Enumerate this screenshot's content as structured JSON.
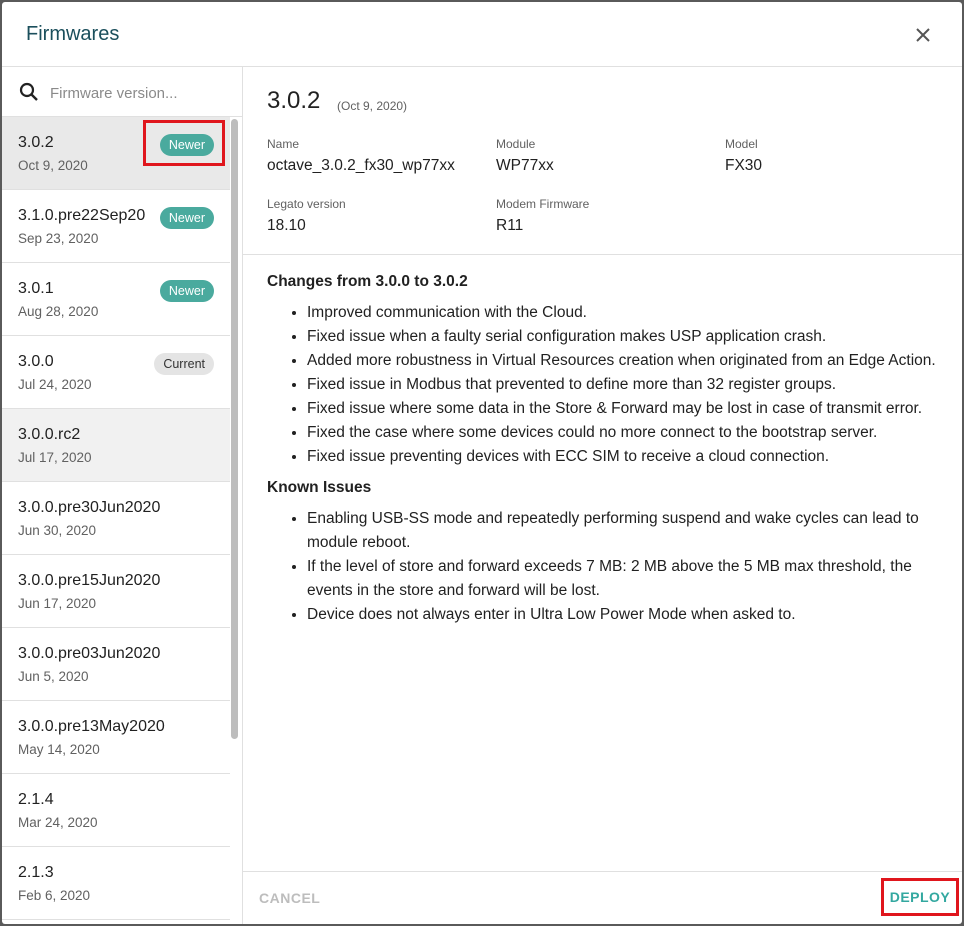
{
  "dialog": {
    "title": "Firmwares"
  },
  "search": {
    "placeholder": "Firmware version..."
  },
  "firmwares": [
    {
      "version": "3.0.2",
      "date": "Oct 9, 2020",
      "badge": "Newer"
    },
    {
      "version": "3.1.0.pre22Sep20",
      "date": "Sep 23, 2020",
      "badge": "Newer"
    },
    {
      "version": "3.0.1",
      "date": "Aug 28, 2020",
      "badge": "Newer"
    },
    {
      "version": "3.0.0",
      "date": "Jul 24, 2020",
      "badge": "Current"
    },
    {
      "version": "3.0.0.rc2",
      "date": "Jul 17, 2020"
    },
    {
      "version": "3.0.0.pre30Jun2020",
      "date": "Jun 30, 2020"
    },
    {
      "version": "3.0.0.pre15Jun2020",
      "date": "Jun 17, 2020"
    },
    {
      "version": "3.0.0.pre03Jun2020",
      "date": "Jun 5, 2020"
    },
    {
      "version": "3.0.0.pre13May2020",
      "date": "May 14, 2020"
    },
    {
      "version": "2.1.4",
      "date": "Mar 24, 2020"
    },
    {
      "version": "2.1.3",
      "date": "Feb 6, 2020"
    }
  ],
  "detail": {
    "version": "3.0.2",
    "date": "(Oct 9, 2020)",
    "fields": {
      "name": {
        "label": "Name",
        "value": "octave_3.0.2_fx30_wp77xx"
      },
      "module": {
        "label": "Module",
        "value": "WP77xx"
      },
      "model": {
        "label": "Model",
        "value": "FX30"
      },
      "legato": {
        "label": "Legato version",
        "value": "18.10"
      },
      "modem": {
        "label": "Modem Firmware",
        "value": "R11"
      }
    },
    "changes_title": "Changes from 3.0.0 to 3.0.2",
    "changes": [
      "Improved communication with the Cloud.",
      "Fixed issue when a faulty serial configuration makes USP application crash.",
      "Added more robustness in Virtual Resources creation when originated from an Edge Action.",
      "Fixed issue in Modbus that prevented to define more than 32 register groups.",
      "Fixed issue where some data in the Store & Forward may be lost in case of transmit error.",
      "Fixed the case where some devices could no more connect to the bootstrap server.",
      "Fixed issue preventing devices with ECC SIM to receive a cloud connection."
    ],
    "known_title": "Known Issues",
    "known": [
      "Enabling USB-SS mode and repeatedly performing suspend and wake cycles can lead to module reboot.",
      "If the level of store and forward exceeds 7 MB: 2 MB above the 5 MB max threshold, the events in the store and forward will be lost.",
      "Device does not always enter in Ultra Low Power Mode when asked to."
    ]
  },
  "footer": {
    "cancel": "CANCEL",
    "deploy": "DEPLOY"
  }
}
